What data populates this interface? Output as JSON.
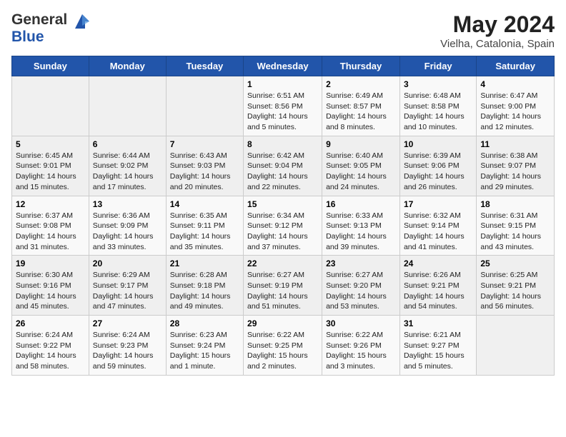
{
  "header": {
    "logo_general": "General",
    "logo_blue": "Blue",
    "month_title": "May 2024",
    "location": "Vielha, Catalonia, Spain"
  },
  "weekdays": [
    "Sunday",
    "Monday",
    "Tuesday",
    "Wednesday",
    "Thursday",
    "Friday",
    "Saturday"
  ],
  "weeks": [
    [
      {
        "day": "",
        "info": ""
      },
      {
        "day": "",
        "info": ""
      },
      {
        "day": "",
        "info": ""
      },
      {
        "day": "1",
        "info": "Sunrise: 6:51 AM\nSunset: 8:56 PM\nDaylight: 14 hours\nand 5 minutes."
      },
      {
        "day": "2",
        "info": "Sunrise: 6:49 AM\nSunset: 8:57 PM\nDaylight: 14 hours\nand 8 minutes."
      },
      {
        "day": "3",
        "info": "Sunrise: 6:48 AM\nSunset: 8:58 PM\nDaylight: 14 hours\nand 10 minutes."
      },
      {
        "day": "4",
        "info": "Sunrise: 6:47 AM\nSunset: 9:00 PM\nDaylight: 14 hours\nand 12 minutes."
      }
    ],
    [
      {
        "day": "5",
        "info": "Sunrise: 6:45 AM\nSunset: 9:01 PM\nDaylight: 14 hours\nand 15 minutes."
      },
      {
        "day": "6",
        "info": "Sunrise: 6:44 AM\nSunset: 9:02 PM\nDaylight: 14 hours\nand 17 minutes."
      },
      {
        "day": "7",
        "info": "Sunrise: 6:43 AM\nSunset: 9:03 PM\nDaylight: 14 hours\nand 20 minutes."
      },
      {
        "day": "8",
        "info": "Sunrise: 6:42 AM\nSunset: 9:04 PM\nDaylight: 14 hours\nand 22 minutes."
      },
      {
        "day": "9",
        "info": "Sunrise: 6:40 AM\nSunset: 9:05 PM\nDaylight: 14 hours\nand 24 minutes."
      },
      {
        "day": "10",
        "info": "Sunrise: 6:39 AM\nSunset: 9:06 PM\nDaylight: 14 hours\nand 26 minutes."
      },
      {
        "day": "11",
        "info": "Sunrise: 6:38 AM\nSunset: 9:07 PM\nDaylight: 14 hours\nand 29 minutes."
      }
    ],
    [
      {
        "day": "12",
        "info": "Sunrise: 6:37 AM\nSunset: 9:08 PM\nDaylight: 14 hours\nand 31 minutes."
      },
      {
        "day": "13",
        "info": "Sunrise: 6:36 AM\nSunset: 9:09 PM\nDaylight: 14 hours\nand 33 minutes."
      },
      {
        "day": "14",
        "info": "Sunrise: 6:35 AM\nSunset: 9:11 PM\nDaylight: 14 hours\nand 35 minutes."
      },
      {
        "day": "15",
        "info": "Sunrise: 6:34 AM\nSunset: 9:12 PM\nDaylight: 14 hours\nand 37 minutes."
      },
      {
        "day": "16",
        "info": "Sunrise: 6:33 AM\nSunset: 9:13 PM\nDaylight: 14 hours\nand 39 minutes."
      },
      {
        "day": "17",
        "info": "Sunrise: 6:32 AM\nSunset: 9:14 PM\nDaylight: 14 hours\nand 41 minutes."
      },
      {
        "day": "18",
        "info": "Sunrise: 6:31 AM\nSunset: 9:15 PM\nDaylight: 14 hours\nand 43 minutes."
      }
    ],
    [
      {
        "day": "19",
        "info": "Sunrise: 6:30 AM\nSunset: 9:16 PM\nDaylight: 14 hours\nand 45 minutes."
      },
      {
        "day": "20",
        "info": "Sunrise: 6:29 AM\nSunset: 9:17 PM\nDaylight: 14 hours\nand 47 minutes."
      },
      {
        "day": "21",
        "info": "Sunrise: 6:28 AM\nSunset: 9:18 PM\nDaylight: 14 hours\nand 49 minutes."
      },
      {
        "day": "22",
        "info": "Sunrise: 6:27 AM\nSunset: 9:19 PM\nDaylight: 14 hours\nand 51 minutes."
      },
      {
        "day": "23",
        "info": "Sunrise: 6:27 AM\nSunset: 9:20 PM\nDaylight: 14 hours\nand 53 minutes."
      },
      {
        "day": "24",
        "info": "Sunrise: 6:26 AM\nSunset: 9:21 PM\nDaylight: 14 hours\nand 54 minutes."
      },
      {
        "day": "25",
        "info": "Sunrise: 6:25 AM\nSunset: 9:21 PM\nDaylight: 14 hours\nand 56 minutes."
      }
    ],
    [
      {
        "day": "26",
        "info": "Sunrise: 6:24 AM\nSunset: 9:22 PM\nDaylight: 14 hours\nand 58 minutes."
      },
      {
        "day": "27",
        "info": "Sunrise: 6:24 AM\nSunset: 9:23 PM\nDaylight: 14 hours\nand 59 minutes."
      },
      {
        "day": "28",
        "info": "Sunrise: 6:23 AM\nSunset: 9:24 PM\nDaylight: 15 hours\nand 1 minute."
      },
      {
        "day": "29",
        "info": "Sunrise: 6:22 AM\nSunset: 9:25 PM\nDaylight: 15 hours\nand 2 minutes."
      },
      {
        "day": "30",
        "info": "Sunrise: 6:22 AM\nSunset: 9:26 PM\nDaylight: 15 hours\nand 3 minutes."
      },
      {
        "day": "31",
        "info": "Sunrise: 6:21 AM\nSunset: 9:27 PM\nDaylight: 15 hours\nand 5 minutes."
      },
      {
        "day": "",
        "info": ""
      }
    ]
  ]
}
